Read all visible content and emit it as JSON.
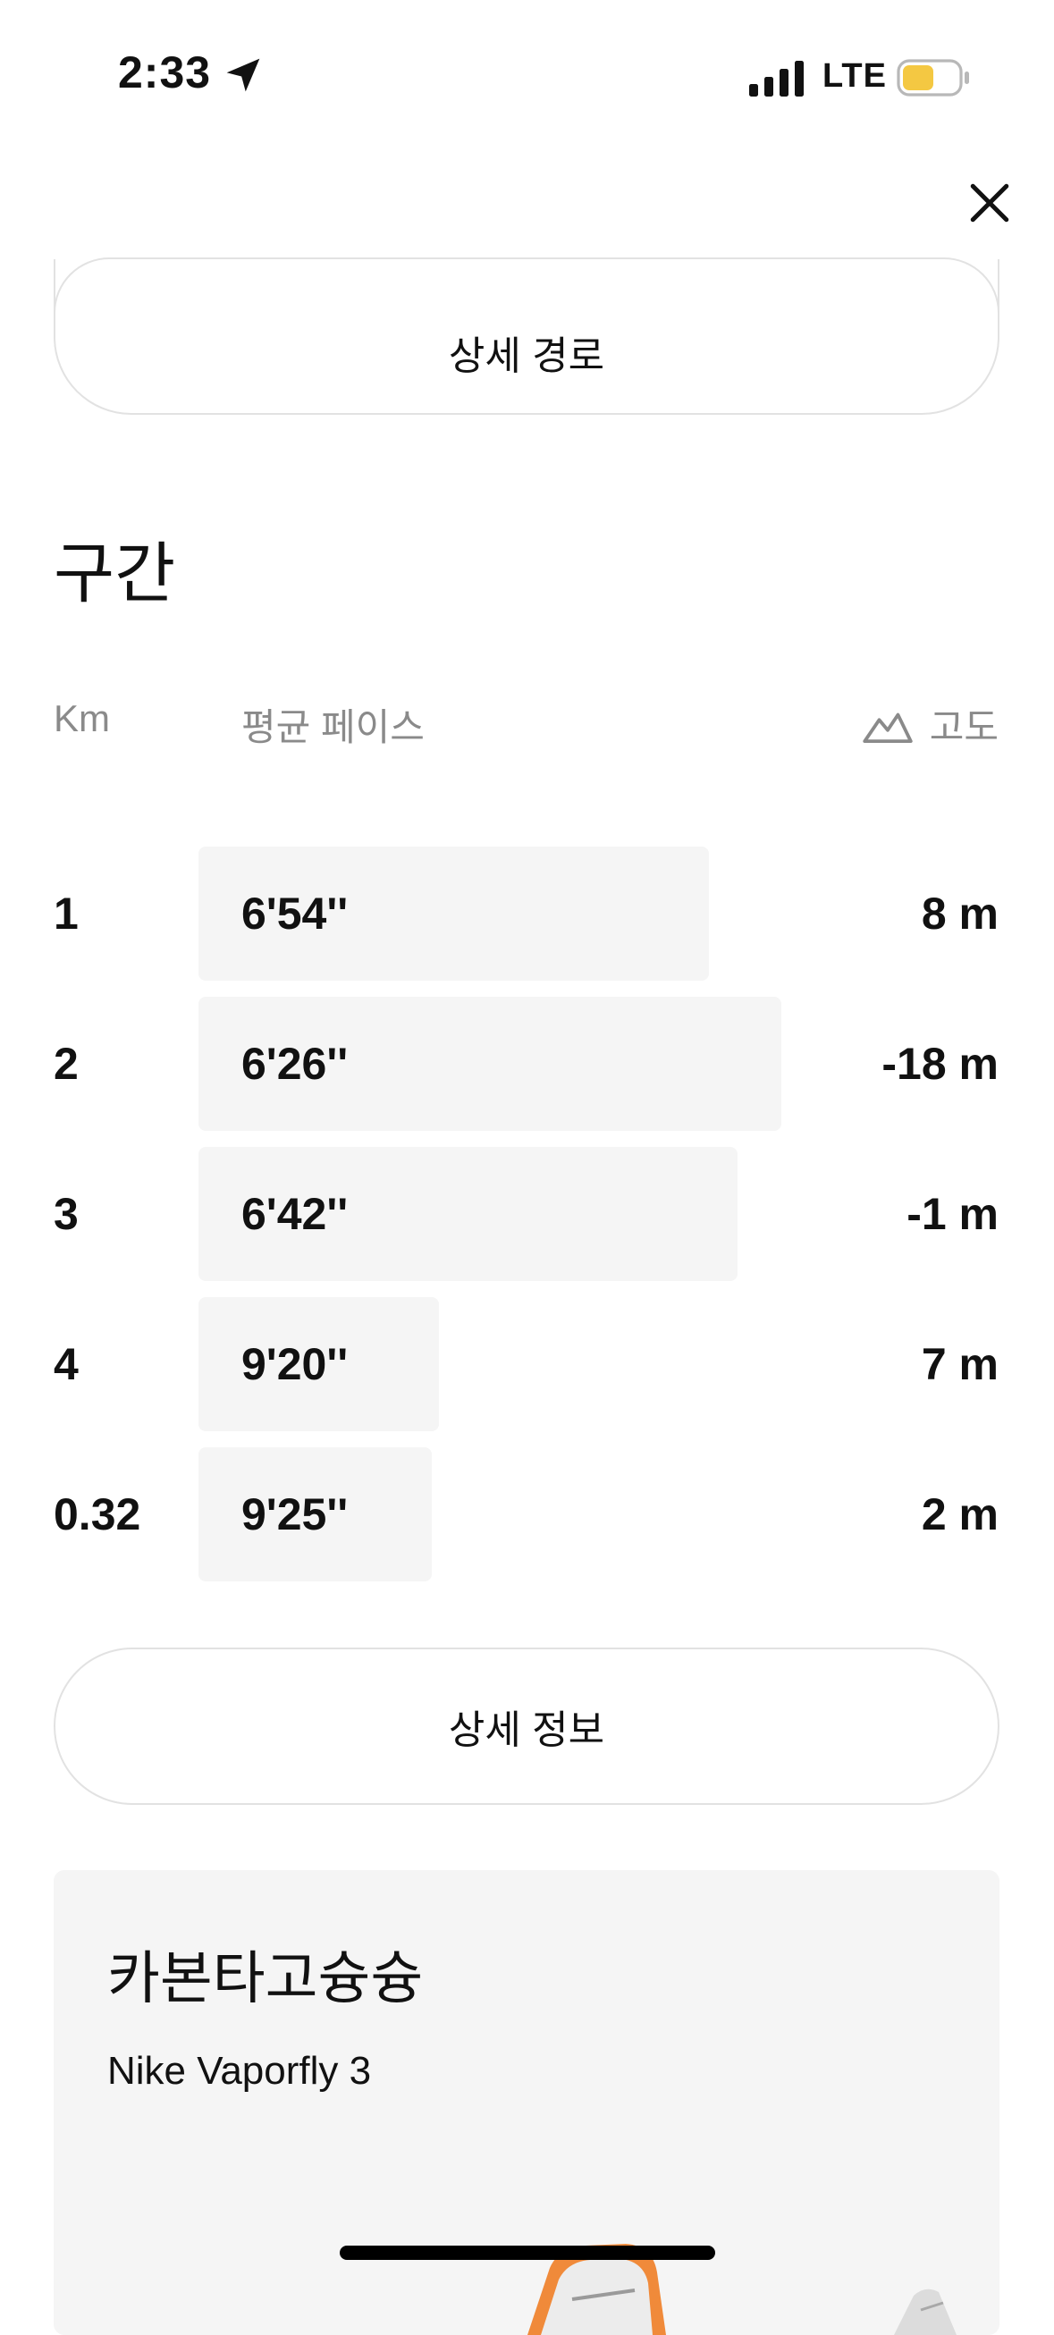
{
  "status_bar": {
    "time": "2:33",
    "network": "LTE",
    "battery_color": "#f4c842"
  },
  "route_button": {
    "label": "상세 경로"
  },
  "splits": {
    "title": "구간",
    "headers": {
      "km": "Km",
      "pace": "평균 페이스",
      "elevation": "고도"
    },
    "rows": [
      {
        "km": "1",
        "pace": "6'54''",
        "elevation": "8 m",
        "pace_bar_fraction": 0.825
      },
      {
        "km": "2",
        "pace": "6'26''",
        "elevation": "-18 m",
        "pace_bar_fraction": 0.942
      },
      {
        "km": "3",
        "pace": "6'42''",
        "elevation": "-1 m",
        "pace_bar_fraction": 0.872
      },
      {
        "km": "4",
        "pace": "9'20''",
        "elevation": "7 m",
        "pace_bar_fraction": 0.389
      },
      {
        "km": "0.32",
        "pace": "9'25''",
        "elevation": "2 m",
        "pace_bar_fraction": 0.377
      }
    ]
  },
  "detail_button": {
    "label": "상세 정보"
  },
  "shoe": {
    "name": "카본타고슝슝",
    "model": "Nike Vaporfly 3"
  },
  "icons": {
    "location": "location-arrow-icon",
    "signal": "cellular-signal-icon",
    "battery": "battery-icon",
    "close": "close-icon",
    "elevation": "mountain-icon"
  }
}
